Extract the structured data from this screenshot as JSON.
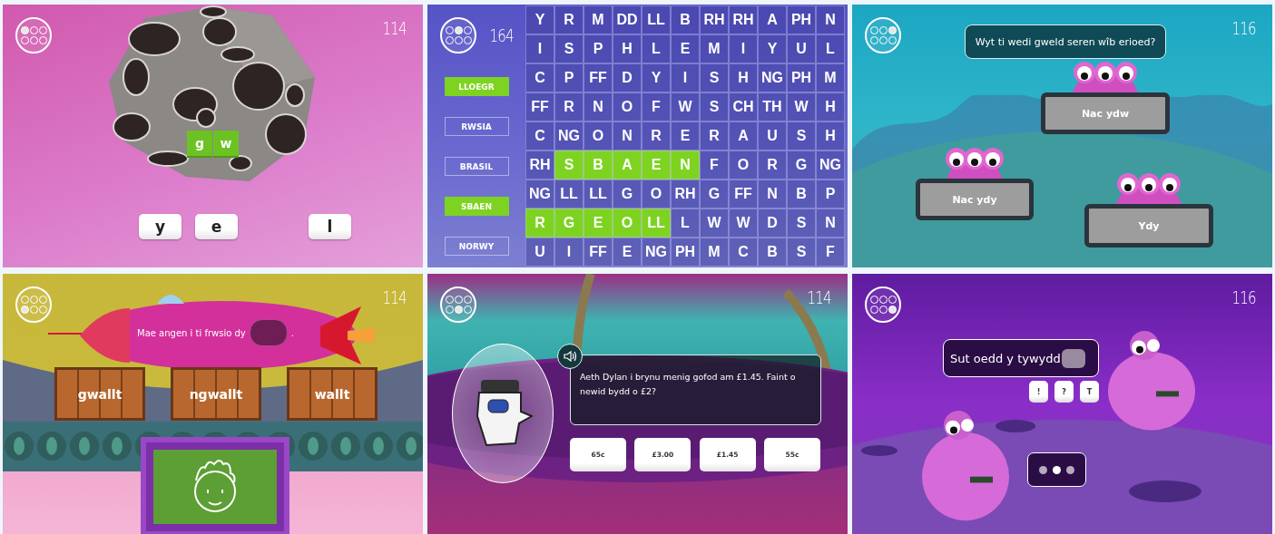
{
  "panels": [
    {
      "kind": "asteroid",
      "score": "114",
      "dots": [
        {
          "selected": true
        },
        {
          "selected": false
        },
        {
          "selected": false
        },
        {
          "selected": false
        },
        {
          "selected": false
        },
        {
          "selected": false
        }
      ],
      "placed": [
        {
          "text": "g"
        },
        {
          "text": "w"
        }
      ],
      "letters": [
        {
          "text": "y"
        },
        {
          "text": "e"
        },
        {
          "text": "l"
        }
      ]
    },
    {
      "kind": "wordsearch",
      "score": "164",
      "dots": [
        {
          "selected": false
        },
        {
          "selected": true
        },
        {
          "selected": false
        },
        {
          "selected": false
        },
        {
          "selected": false
        },
        {
          "selected": false
        }
      ],
      "words": [
        {
          "text": "LLOEGR",
          "found": true
        },
        {
          "text": "RWSIA",
          "found": false
        },
        {
          "text": "BRASIL",
          "found": false
        },
        {
          "text": "SBAEN",
          "found": true
        },
        {
          "text": "NORWY",
          "found": false
        }
      ],
      "grid": [
        [
          {
            "text": "Y",
            "found": false
          },
          {
            "text": "R",
            "found": false
          },
          {
            "text": "M",
            "found": false
          },
          {
            "text": "DD",
            "found": false
          },
          {
            "text": "LL",
            "found": false
          },
          {
            "text": "B",
            "found": false
          },
          {
            "text": "RH",
            "found": false
          },
          {
            "text": "RH",
            "found": false
          },
          {
            "text": "A",
            "found": false
          },
          {
            "text": "PH",
            "found": false
          },
          {
            "text": "N",
            "found": false
          }
        ],
        [
          {
            "text": "I",
            "found": false
          },
          {
            "text": "S",
            "found": false
          },
          {
            "text": "P",
            "found": false
          },
          {
            "text": "H",
            "found": false
          },
          {
            "text": "L",
            "found": false
          },
          {
            "text": "E",
            "found": false
          },
          {
            "text": "M",
            "found": false
          },
          {
            "text": "I",
            "found": false
          },
          {
            "text": "Y",
            "found": false
          },
          {
            "text": "U",
            "found": false
          },
          {
            "text": "L",
            "found": false
          }
        ],
        [
          {
            "text": "C",
            "found": false
          },
          {
            "text": "P",
            "found": false
          },
          {
            "text": "FF",
            "found": false
          },
          {
            "text": "D",
            "found": false
          },
          {
            "text": "Y",
            "found": false
          },
          {
            "text": "I",
            "found": false
          },
          {
            "text": "S",
            "found": false
          },
          {
            "text": "H",
            "found": false
          },
          {
            "text": "NG",
            "found": false
          },
          {
            "text": "PH",
            "found": false
          },
          {
            "text": "M",
            "found": false
          }
        ],
        [
          {
            "text": "FF",
            "found": false
          },
          {
            "text": "R",
            "found": false
          },
          {
            "text": "N",
            "found": false
          },
          {
            "text": "O",
            "found": false
          },
          {
            "text": "F",
            "found": false
          },
          {
            "text": "W",
            "found": false
          },
          {
            "text": "S",
            "found": false
          },
          {
            "text": "CH",
            "found": false
          },
          {
            "text": "TH",
            "found": false
          },
          {
            "text": "W",
            "found": false
          },
          {
            "text": "H",
            "found": false
          }
        ],
        [
          {
            "text": "C",
            "found": false
          },
          {
            "text": "NG",
            "found": false
          },
          {
            "text": "O",
            "found": false
          },
          {
            "text": "N",
            "found": false
          },
          {
            "text": "R",
            "found": false
          },
          {
            "text": "E",
            "found": false
          },
          {
            "text": "R",
            "found": false
          },
          {
            "text": "A",
            "found": false
          },
          {
            "text": "U",
            "found": false
          },
          {
            "text": "S",
            "found": false
          },
          {
            "text": "H",
            "found": false
          }
        ],
        [
          {
            "text": "RH",
            "found": false
          },
          {
            "text": "S",
            "found": true
          },
          {
            "text": "B",
            "found": true
          },
          {
            "text": "A",
            "found": true
          },
          {
            "text": "E",
            "found": true
          },
          {
            "text": "N",
            "found": true
          },
          {
            "text": "F",
            "found": false
          },
          {
            "text": "O",
            "found": false
          },
          {
            "text": "R",
            "found": false
          },
          {
            "text": "G",
            "found": false
          },
          {
            "text": "NG",
            "found": false
          }
        ],
        [
          {
            "text": "NG",
            "found": false
          },
          {
            "text": "LL",
            "found": false
          },
          {
            "text": "LL",
            "found": false
          },
          {
            "text": "G",
            "found": false
          },
          {
            "text": "O",
            "found": false
          },
          {
            "text": "RH",
            "found": false
          },
          {
            "text": "G",
            "found": false
          },
          {
            "text": "FF",
            "found": false
          },
          {
            "text": "N",
            "found": false
          },
          {
            "text": "B",
            "found": false
          },
          {
            "text": "P",
            "found": false
          }
        ],
        [
          {
            "text": "R",
            "found": true
          },
          {
            "text": "G",
            "found": true
          },
          {
            "text": "E",
            "found": true
          },
          {
            "text": "O",
            "found": true
          },
          {
            "text": "LL",
            "found": true
          },
          {
            "text": "L",
            "found": false
          },
          {
            "text": "W",
            "found": false
          },
          {
            "text": "W",
            "found": false
          },
          {
            "text": "D",
            "found": false
          },
          {
            "text": "S",
            "found": false
          },
          {
            "text": "N",
            "found": false
          }
        ],
        [
          {
            "text": "U",
            "found": false
          },
          {
            "text": "I",
            "found": false
          },
          {
            "text": "FF",
            "found": false
          },
          {
            "text": "E",
            "found": false
          },
          {
            "text": "NG",
            "found": false
          },
          {
            "text": "PH",
            "found": false
          },
          {
            "text": "M",
            "found": false
          },
          {
            "text": "C",
            "found": false
          },
          {
            "text": "B",
            "found": false
          },
          {
            "text": "S",
            "found": false
          },
          {
            "text": "F",
            "found": false
          }
        ]
      ]
    },
    {
      "kind": "monsters",
      "score": "116",
      "dots": [
        {
          "selected": false
        },
        {
          "selected": false
        },
        {
          "selected": true
        },
        {
          "selected": false
        },
        {
          "selected": false
        },
        {
          "selected": false
        }
      ],
      "question": "Wyt ti wedi gweld seren wîb erioed?",
      "answers": [
        {
          "text": "Nac ydw"
        },
        {
          "text": "Nac ydy"
        },
        {
          "text": "Ydy"
        }
      ]
    },
    {
      "kind": "rocket",
      "score": "114",
      "dots": [
        {
          "selected": false
        },
        {
          "selected": false
        },
        {
          "selected": false
        },
        {
          "selected": true
        },
        {
          "selected": false
        },
        {
          "selected": false
        }
      ],
      "sentence": "Mae angen i ti frwsio dy",
      "end": ".",
      "crates": [
        {
          "text": "gwallt"
        },
        {
          "text": "ngwallt"
        },
        {
          "text": "wallt"
        }
      ]
    },
    {
      "kind": "quiz",
      "score": "114",
      "dots": [
        {
          "selected": false
        },
        {
          "selected": false
        },
        {
          "selected": false
        },
        {
          "selected": false
        },
        {
          "selected": true
        },
        {
          "selected": false
        }
      ],
      "question": "Aeth Dylan i brynu menig gofod am £1.45. Faint o newid bydd o £2?",
      "answers": [
        {
          "text": "65c"
        },
        {
          "text": "£3.00"
        },
        {
          "text": "£1.45"
        },
        {
          "text": "55c"
        }
      ]
    },
    {
      "kind": "chat",
      "score": "116",
      "dots": [
        {
          "selected": false
        },
        {
          "selected": false
        },
        {
          "selected": false
        },
        {
          "selected": false
        },
        {
          "selected": false
        },
        {
          "selected": true
        }
      ],
      "message": "Sut oedd y tywydd",
      "keys": [
        {
          "text": "!"
        },
        {
          "text": "?"
        },
        {
          "text": "T"
        }
      ]
    }
  ]
}
